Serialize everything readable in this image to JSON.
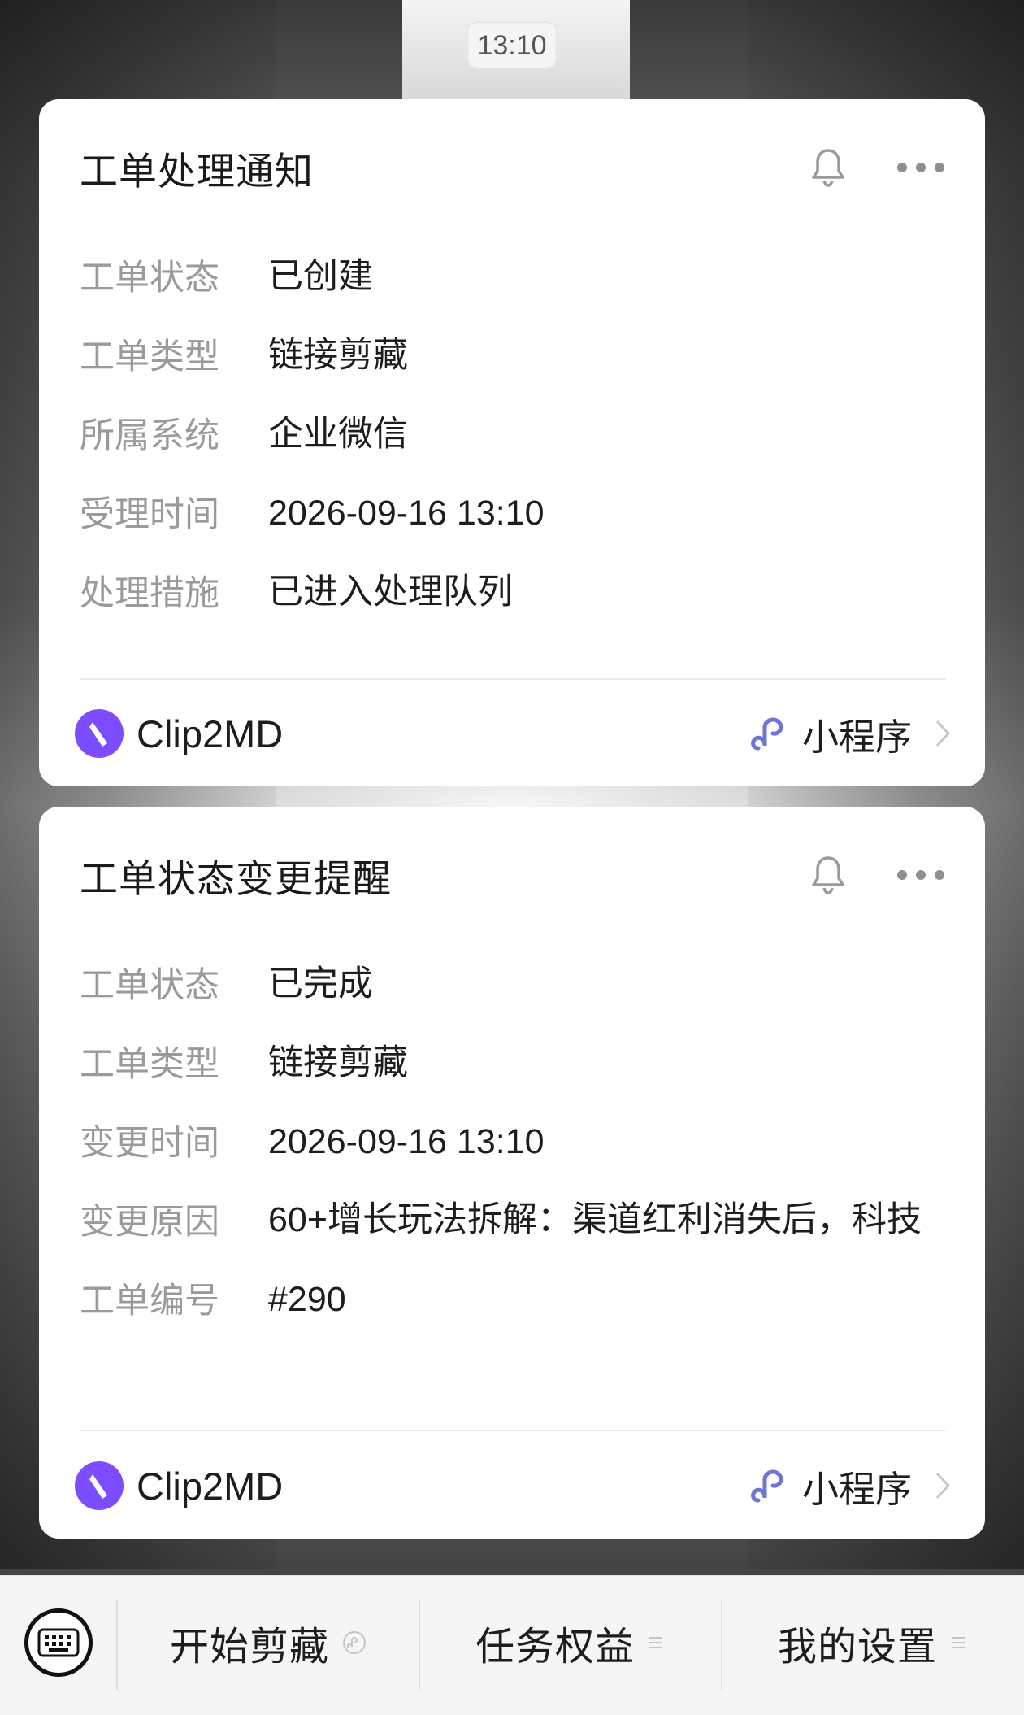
{
  "status_bar": {
    "time": "13:10"
  },
  "cards": [
    {
      "title": "工单处理通知",
      "fields": [
        {
          "label": "工单状态",
          "value": "已创建"
        },
        {
          "label": "工单类型",
          "value": "链接剪藏"
        },
        {
          "label": "所属系统",
          "value": "企业微信"
        },
        {
          "label": "受理时间",
          "value": "2026-09-16 13:10"
        },
        {
          "label": "处理措施",
          "value": "已进入处理队列"
        }
      ],
      "app_name": "Clip2MD",
      "mini_program_label": "小程序"
    },
    {
      "title": "工单状态变更提醒",
      "fields": [
        {
          "label": "工单状态",
          "value": "已完成"
        },
        {
          "label": "工单类型",
          "value": "链接剪藏"
        },
        {
          "label": "变更时间",
          "value": "2026-09-16 13:10"
        },
        {
          "label": "变更原因",
          "value": "60+增长玩法拆解：渠道红利消失后，科技"
        },
        {
          "label": "工单编号",
          "value": "#290"
        }
      ],
      "app_name": "Clip2MD",
      "mini_program_label": "小程序"
    }
  ],
  "bottom_menu": {
    "items": [
      {
        "label": "开始剪藏",
        "icon": "mini-program-icon"
      },
      {
        "label": "任务权益",
        "icon": "submenu-lines-icon"
      },
      {
        "label": "我的设置",
        "icon": "submenu-lines-icon"
      }
    ]
  },
  "colors": {
    "brand_purple": "#7c4dff",
    "mini_program_link": "#6f74d6",
    "label_gray": "#9a9a9a"
  }
}
